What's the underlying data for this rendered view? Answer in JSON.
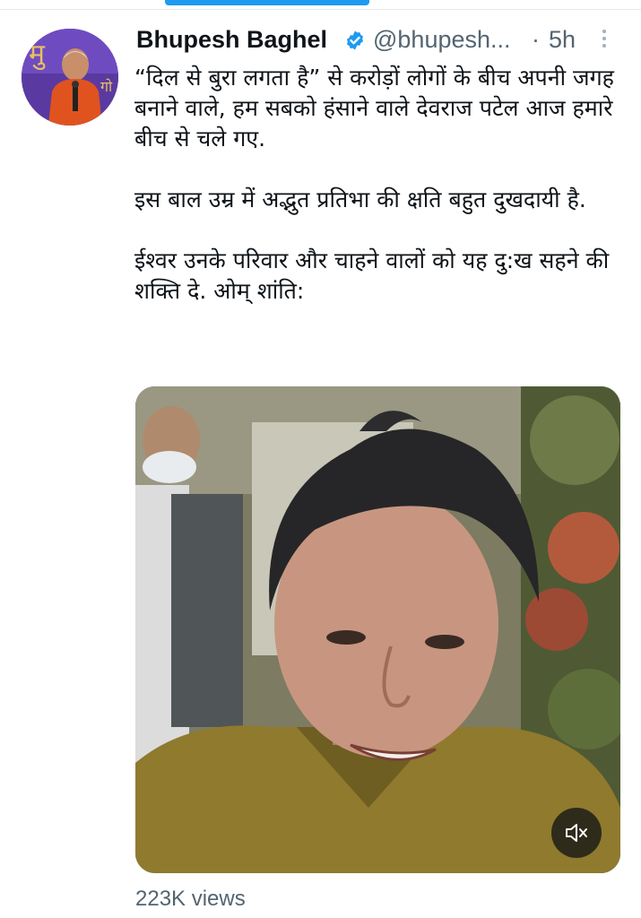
{
  "author": {
    "name": "Bhupesh Baghel",
    "handle": "@bhupesh...",
    "separator": "·",
    "time": "5h",
    "verified": true,
    "avatar_icon": "profile-photo"
  },
  "tweet": {
    "paragraphs": [
      "“दिल से बुरा लगता है” से करोड़ों लोगों के बीच अपनी जगह बनाने वाले, हम सबको हंसाने वाले देवराज पटेल आज हमारे बीच से चले गए.",
      "इस बाल उम्र में अद्भुत प्रतिभा की क्षति बहुत दुखदायी है.",
      "ईश्वर उनके परिवार और चाहने वालों को यह दु:ख सहने की शक्ति दे. ओम् शांति:"
    ]
  },
  "media": {
    "type": "video",
    "mute_icon": "speaker-muted-icon"
  },
  "stats": {
    "views": "223K views"
  },
  "colors": {
    "accent": "#1d9bf0",
    "text": "#0f1419",
    "secondary": "#536471"
  }
}
